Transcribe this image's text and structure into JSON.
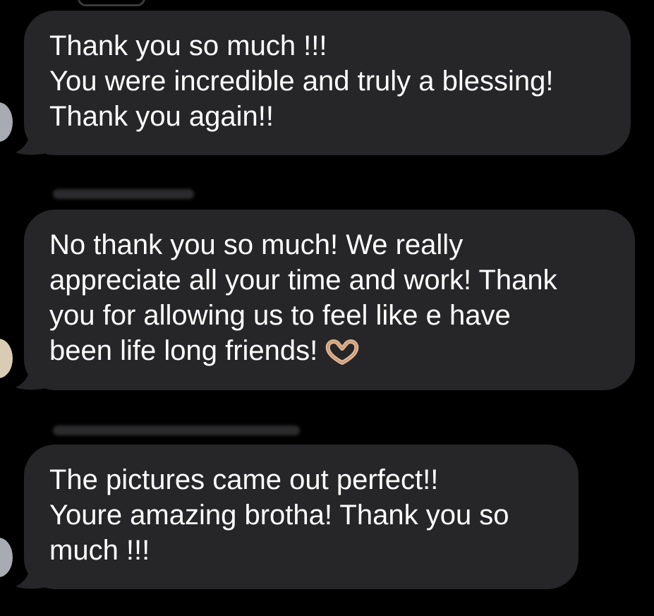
{
  "messages": [
    {
      "lines": [
        "Thank you so much !!!",
        "You were incredible and truly a blessing!",
        "Thank you again!!"
      ],
      "avatar_color": "#a9abb2"
    },
    {
      "lines": [
        "No thank you so much! We really",
        "appreciate all your time and work! Thank",
        "you for allowing us to feel like e have",
        "been life long friends!"
      ],
      "emoji_icon": "heart-hands-icon",
      "avatar_color": "#d8cdb4"
    },
    {
      "lines": [
        "The pictures came out perfect!!",
        "Youre amazing brotha! Thank you so",
        "much !!!"
      ],
      "avatar_color": "#a9abb2"
    }
  ],
  "colors": {
    "background": "#000000",
    "bubble": "#262628",
    "text": "#ffffff"
  }
}
